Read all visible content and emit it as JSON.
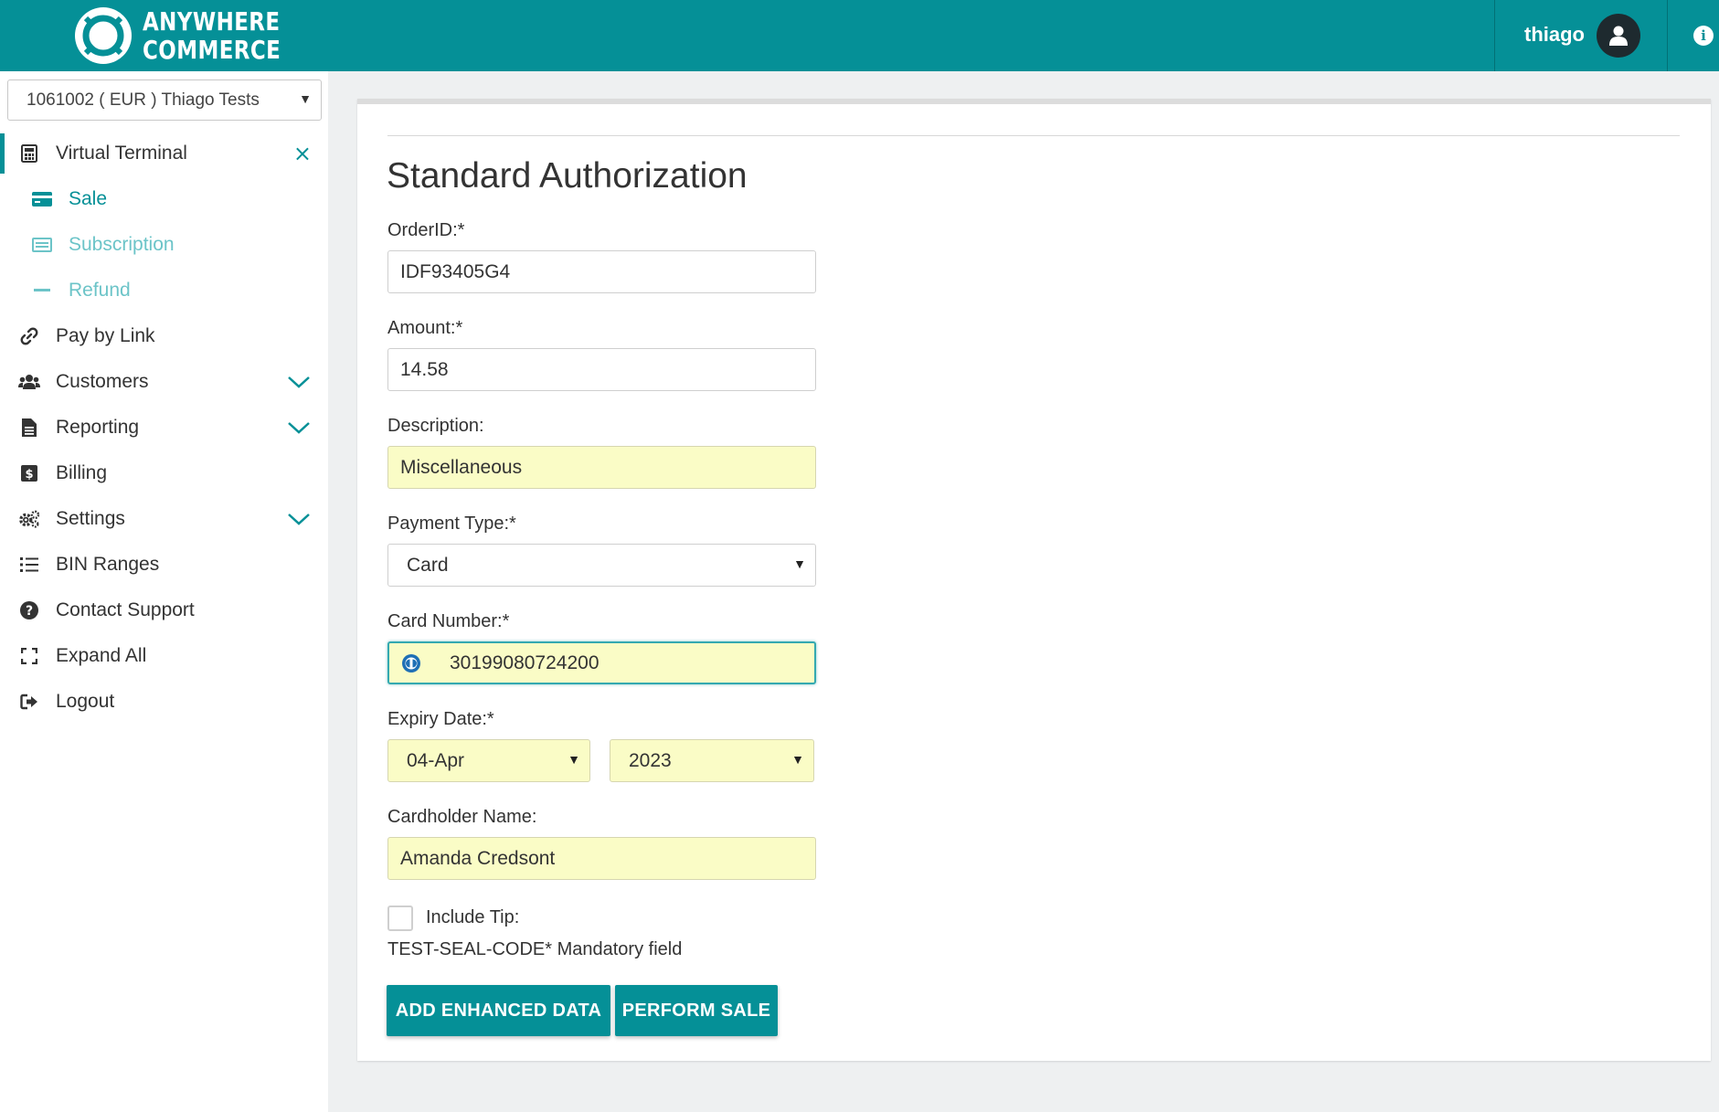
{
  "brand": {
    "line1": "ANYWHERE",
    "line2": "COMMERCE"
  },
  "header": {
    "username": "thiago",
    "accent": "#059097"
  },
  "sidebar": {
    "merchant": "1061002 ( EUR ) Thiago Tests",
    "virtual_terminal": "Virtual Terminal",
    "sub": {
      "sale": "Sale",
      "subscription": "Subscription",
      "refund": "Refund"
    },
    "items": {
      "pay_by_link": "Pay by Link",
      "customers": "Customers",
      "reporting": "Reporting",
      "billing": "Billing",
      "settings": "Settings",
      "bin_ranges": "BIN Ranges",
      "contact_support": "Contact Support",
      "expand_all": "Expand All",
      "logout": "Logout"
    }
  },
  "form": {
    "title": "Standard Authorization",
    "order_id": {
      "label": "OrderID:*",
      "value": "IDF93405G4"
    },
    "amount": {
      "label": "Amount:*",
      "value": "14.58"
    },
    "description": {
      "label": "Description:",
      "value": "Miscellaneous"
    },
    "payment_type": {
      "label": "Payment Type:*",
      "value": "Card"
    },
    "card_number": {
      "label": "Card Number:*",
      "value": "30199080724200"
    },
    "expiry": {
      "label": "Expiry Date:*",
      "month": "04-Apr",
      "year": "2023"
    },
    "cardholder": {
      "label": "Cardholder Name:",
      "value": "Amanda Credsont"
    },
    "include_tip": {
      "label": "Include Tip:",
      "checked": false
    },
    "note": "TEST-SEAL-CODE* Mandatory field",
    "buttons": {
      "enhanced": "ADD ENHANCED DATA",
      "sale": "PERFORM SALE"
    }
  }
}
